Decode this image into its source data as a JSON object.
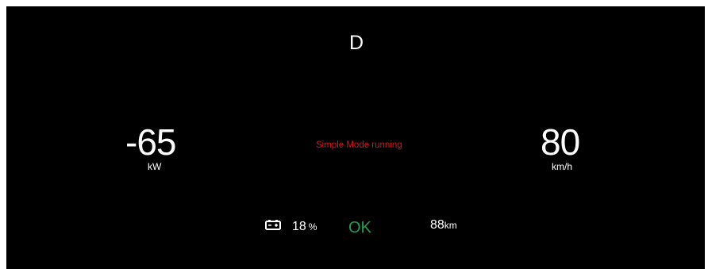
{
  "gear": {
    "label": "D"
  },
  "power": {
    "value": "-65",
    "unit": "kW"
  },
  "mode": {
    "status_text": "Simple Mode running",
    "color": "#e01010"
  },
  "speed": {
    "value": "80",
    "unit": "km/h"
  },
  "battery": {
    "icon": "battery-icon",
    "percent": "18",
    "unit": "%"
  },
  "status": {
    "label": "OK",
    "color": "#1fa14a"
  },
  "range": {
    "value": "88",
    "unit": "km"
  }
}
